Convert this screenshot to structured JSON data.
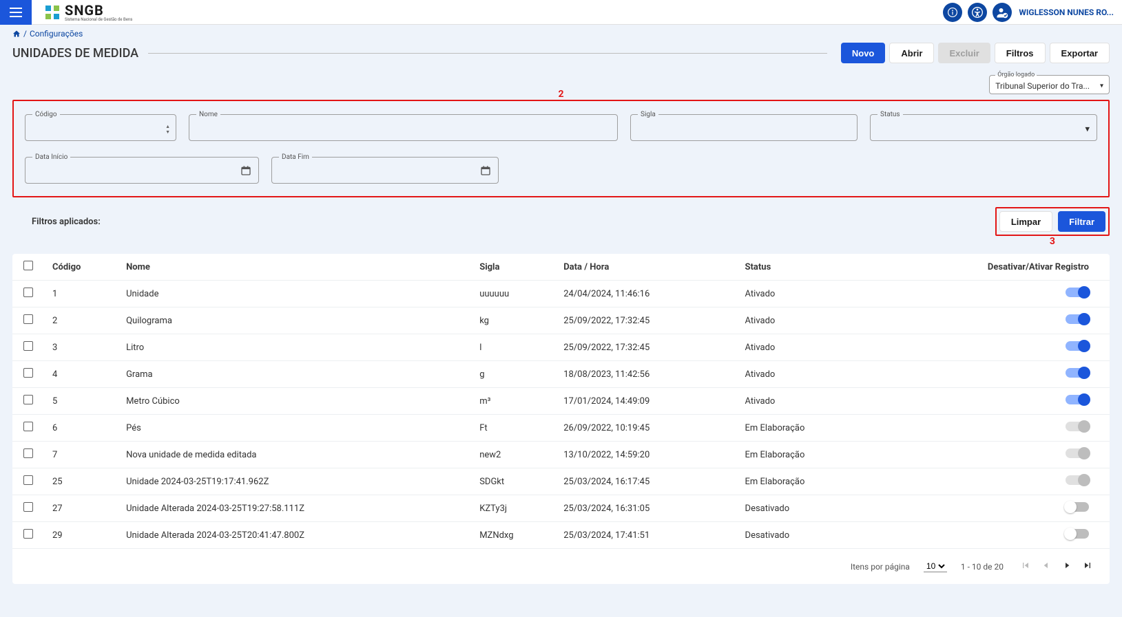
{
  "topbar": {
    "logo_text": "SNGB",
    "logo_sub": "Sistema Nacional de Gestão de Bens",
    "user_name": "WIGLESSON NUNES RO..."
  },
  "breadcrumb": {
    "sep": " / ",
    "item": "Configurações"
  },
  "page_title": "UNIDADES DE MEDIDA",
  "header_buttons": {
    "novo": "Novo",
    "abrir": "Abrir",
    "excluir": "Excluir",
    "filtros": "Filtros",
    "exportar": "Exportar"
  },
  "orgao": {
    "label": "Órgão logado",
    "value": "Tribunal Superior do Tra..."
  },
  "annotations": {
    "filter_box": "2",
    "button_group": "3"
  },
  "filters": {
    "codigo": "Código",
    "nome": "Nome",
    "sigla": "Sigla",
    "status": "Status",
    "data_inicio": "Data Início",
    "data_fim": "Data Fim"
  },
  "applied_filters_label": "Filtros aplicados:",
  "filter_buttons": {
    "limpar": "Limpar",
    "filtrar": "Filtrar"
  },
  "table": {
    "headers": {
      "codigo": "Código",
      "nome": "Nome",
      "sigla": "Sigla",
      "data_hora": "Data / Hora",
      "status": "Status",
      "toggle": "Desativar/Ativar Registro"
    },
    "rows": [
      {
        "codigo": "1",
        "nome": "Unidade",
        "sigla": "uuuuuu",
        "data": "24/04/2024, 11:46:16",
        "status": "Ativado",
        "toggle": "on"
      },
      {
        "codigo": "2",
        "nome": "Quilograma",
        "sigla": "kg",
        "data": "25/09/2022, 17:32:45",
        "status": "Ativado",
        "toggle": "on"
      },
      {
        "codigo": "3",
        "nome": "Litro",
        "sigla": "l",
        "data": "25/09/2022, 17:32:45",
        "status": "Ativado",
        "toggle": "on"
      },
      {
        "codigo": "4",
        "nome": "Grama",
        "sigla": "g",
        "data": "18/08/2023, 11:42:56",
        "status": "Ativado",
        "toggle": "on"
      },
      {
        "codigo": "5",
        "nome": "Metro Cúbico",
        "sigla": "m³",
        "data": "17/01/2024, 14:49:09",
        "status": "Ativado",
        "toggle": "on"
      },
      {
        "codigo": "6",
        "nome": "Pés",
        "sigla": "Ft",
        "data": "26/09/2022, 10:19:45",
        "status": "Em Elaboração",
        "toggle": "disabled"
      },
      {
        "codigo": "7",
        "nome": "Nova unidade de medida editada",
        "sigla": "new2",
        "data": "13/10/2022, 14:59:20",
        "status": "Em Elaboração",
        "toggle": "disabled"
      },
      {
        "codigo": "25",
        "nome": "Unidade 2024-03-25T19:17:41.962Z",
        "sigla": "SDGkt",
        "data": "25/03/2024, 16:17:45",
        "status": "Em Elaboração",
        "toggle": "disabled"
      },
      {
        "codigo": "27",
        "nome": "Unidade Alterada 2024-03-25T19:27:58.111Z",
        "sigla": "KZTy3j",
        "data": "25/03/2024, 16:31:05",
        "status": "Desativado",
        "toggle": "off"
      },
      {
        "codigo": "29",
        "nome": "Unidade Alterada 2024-03-25T20:41:47.800Z",
        "sigla": "MZNdxg",
        "data": "25/03/2024, 17:41:51",
        "status": "Desativado",
        "toggle": "off"
      }
    ]
  },
  "pager": {
    "items_label": "Itens por página",
    "page_size": "10",
    "range": "1 - 10 de 20"
  }
}
